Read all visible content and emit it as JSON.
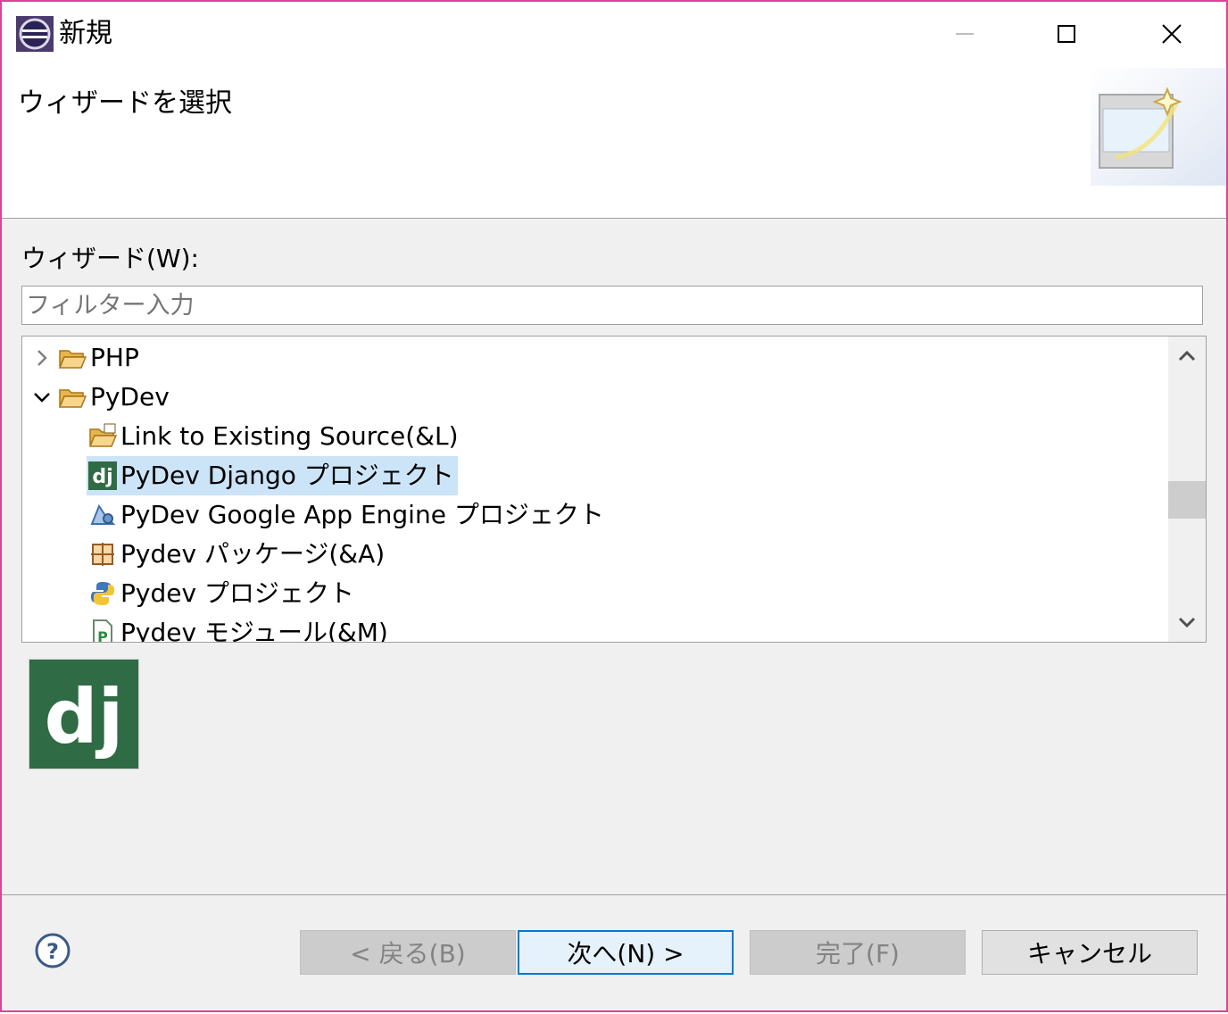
{
  "window": {
    "title": "新規"
  },
  "header": {
    "title": "ウィザードを選択"
  },
  "wizards": {
    "label": "ウィザード(W):",
    "filter_placeholder": "フィルター入力",
    "tree": [
      {
        "label": "PHP",
        "expanded": false,
        "icon": "folder-icon"
      },
      {
        "label": "PyDev",
        "expanded": true,
        "icon": "folder-open-icon"
      },
      {
        "label": "Link to Existing Source(&L)",
        "icon": "link-folder-icon"
      },
      {
        "label": "PyDev Django プロジェクト",
        "icon": "django-icon",
        "selected": true
      },
      {
        "label": "PyDev Google App Engine プロジェクト",
        "icon": "google-app-engine-icon"
      },
      {
        "label": "Pydev パッケージ(&A)",
        "icon": "package-icon"
      },
      {
        "label": "Pydev プロジェクト",
        "icon": "python-icon"
      },
      {
        "label": "Pydev モジュール(&M)",
        "icon": "module-icon"
      }
    ]
  },
  "buttons": {
    "back": "< 戻る(B)",
    "next": "次へ(N) >",
    "finish": "完了(F)",
    "cancel": "キャンセル"
  },
  "colors": {
    "selection": "#cce4f7",
    "django": "#2f6b44",
    "accent": "#0078d7",
    "border": "#e0419a"
  }
}
